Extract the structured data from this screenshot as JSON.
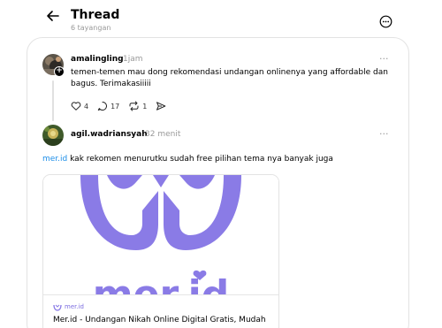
{
  "header": {
    "title": "Thread",
    "subtitle": "6 tayangan",
    "back_icon": "arrow-left-icon",
    "more_icon": "ellipsis-circle-icon"
  },
  "posts": [
    {
      "username": "amalingling",
      "time": "1jam",
      "more": "···",
      "text_line1": "temen-temen mau dong rekomendasi undangan onlinenya yang affordable dan",
      "text_line2": "bagus. Terimakasiiiii",
      "likes": "4",
      "replies": "17",
      "reposts": "1"
    },
    {
      "username": "agil.wadriansyah",
      "time": "32 menit",
      "more": "···",
      "text_link": "mer.id",
      "text_rest": " kak rekomen menurutku sudah free pilihan tema nya banyak juga",
      "preview": {
        "logo_text": "mer.id",
        "domain": "mer.id",
        "title": "Mer.id - Undangan Nikah Online Digital Gratis, Mudah"
      }
    }
  ],
  "colors": {
    "brand_purple": "#8a7be6",
    "link_blue": "#1d8ee8",
    "muted": "#999999",
    "border": "#e3e3e3"
  }
}
